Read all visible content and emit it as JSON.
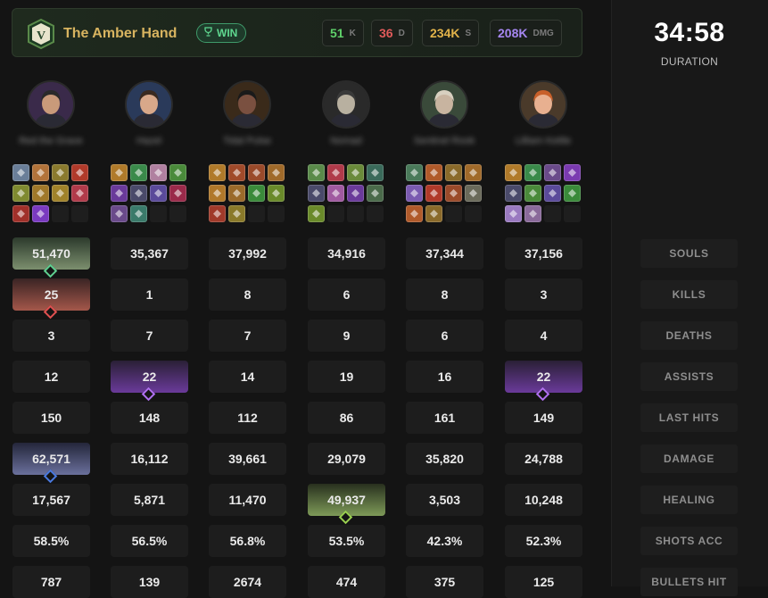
{
  "team": {
    "emblem_letter": "V",
    "name": "The Amber Hand",
    "result": "WIN",
    "stats": [
      {
        "value": "51",
        "unit": "K",
        "color": "#5fd06a"
      },
      {
        "value": "36",
        "unit": "D",
        "color": "#e05a5a"
      },
      {
        "value": "234K",
        "unit": "S",
        "color": "#e2b34a"
      },
      {
        "value": "208K",
        "unit": "DMG",
        "color": "#a586f0"
      }
    ]
  },
  "duration": {
    "value": "34:58",
    "label": "DURATION"
  },
  "row_labels": [
    "SOULS",
    "KILLS",
    "DEATHS",
    "ASSISTS",
    "LAST HITS",
    "DAMAGE",
    "HEALING",
    "SHOTS ACC",
    "BULLETS HIT"
  ],
  "players": [
    {
      "name": "Red the Grave",
      "avatar_icon": "hero-avatar-icon",
      "stats": [
        "51,470",
        "25",
        "3",
        "12",
        "150",
        "62,571",
        "17,567",
        "58.5%",
        "787"
      ],
      "items": [
        "#6a7e98",
        "#b2733a",
        "#8a7a2e",
        "#b03a2a",
        "#7f8a30",
        "#a0782a",
        "#a0822a",
        "#b03a4a",
        "#a0302a",
        "#7a3ac0",
        "",
        ""
      ]
    },
    {
      "name": "Hazel",
      "avatar_icon": "hero-avatar-icon",
      "stats": [
        "35,367",
        "1",
        "7",
        "22",
        "148",
        "16,112",
        "5,871",
        "56.5%",
        "139"
      ],
      "items": [
        "#b07a2a",
        "#3a8a4a",
        "#b080a0",
        "#4a8a3a",
        "#6a3a9a",
        "#4a4a6a",
        "#5a4a9a",
        "#9a2a4a",
        "#6a4a8a",
        "#3a7a6a",
        "",
        ""
      ]
    },
    {
      "name": "Tidal Pulse",
      "avatar_icon": "hero-avatar-icon",
      "stats": [
        "37,992",
        "8",
        "7",
        "14",
        "112",
        "39,661",
        "11,470",
        "56.8%",
        "2674"
      ],
      "items": [
        "#b07a2a",
        "#a04a2a",
        "#9a4a2a",
        "#a06a2a",
        "#b0782a",
        "#9a6a2a",
        "#3a8a3a",
        "#6a8a2a",
        "#a03a2a",
        "#8a7a2a",
        "",
        ""
      ]
    },
    {
      "name": "Nomad",
      "avatar_icon": "hero-avatar-icon",
      "stats": [
        "34,916",
        "6",
        "9",
        "19",
        "86",
        "29,079",
        "49,937",
        "53.5%",
        "474"
      ],
      "items": [
        "#5a8a4a",
        "#b03a4a",
        "#6a8a3a",
        "#3a6a5a",
        "#4a4a6a",
        "#a05aa0",
        "#6a3a9a",
        "#4a6a4a",
        "#6a8a2a",
        "",
        "",
        ""
      ]
    },
    {
      "name": "Sentinel Rook",
      "avatar_icon": "hero-avatar-icon",
      "stats": [
        "37,344",
        "8",
        "6",
        "16",
        "161",
        "35,820",
        "3,503",
        "42.3%",
        "375"
      ],
      "items": [
        "#4a7a5a",
        "#b05a2a",
        "#8a6a2a",
        "#a06a2a",
        "#7a5ab0",
        "#b03a2a",
        "#9a4a2a",
        "#6a6a5a",
        "#b05a2a",
        "#8a6a2a",
        "",
        ""
      ]
    },
    {
      "name": "Lilliam Kettle",
      "avatar_icon": "hero-avatar-icon",
      "stats": [
        "37,156",
        "3",
        "4",
        "22",
        "149",
        "24,788",
        "10,248",
        "52.3%",
        "125"
      ],
      "items": [
        "#b07a2a",
        "#3a8a4a",
        "#6a4a8a",
        "#7a3ab0",
        "#4a4a6a",
        "#4a8a3a",
        "#5a4a9a",
        "#3a8a3a",
        "#9a7ac0",
        "#8a6a9a",
        "",
        ""
      ]
    }
  ],
  "highlights": [
    {
      "player": 0,
      "row": 0,
      "class": "hl-souls",
      "marker_color": "#5fd090",
      "marker_icon": "souls-diamond-icon"
    },
    {
      "player": 0,
      "row": 1,
      "class": "hl-kills",
      "marker_color": "#e05050",
      "marker_icon": "kills-diamond-icon"
    },
    {
      "player": 1,
      "row": 3,
      "class": "hl-assists",
      "marker_color": "#b070f0",
      "marker_icon": "assists-diamond-icon"
    },
    {
      "player": 5,
      "row": 3,
      "class": "hl-assists",
      "marker_color": "#b070f0",
      "marker_icon": "assists-diamond-icon"
    },
    {
      "player": 0,
      "row": 5,
      "class": "hl-damage",
      "marker_color": "#4a7ae0",
      "marker_icon": "damage-diamond-icon"
    },
    {
      "player": 3,
      "row": 6,
      "class": "hl-healing",
      "marker_color": "#9ad050",
      "marker_icon": "healing-diamond-icon"
    }
  ]
}
